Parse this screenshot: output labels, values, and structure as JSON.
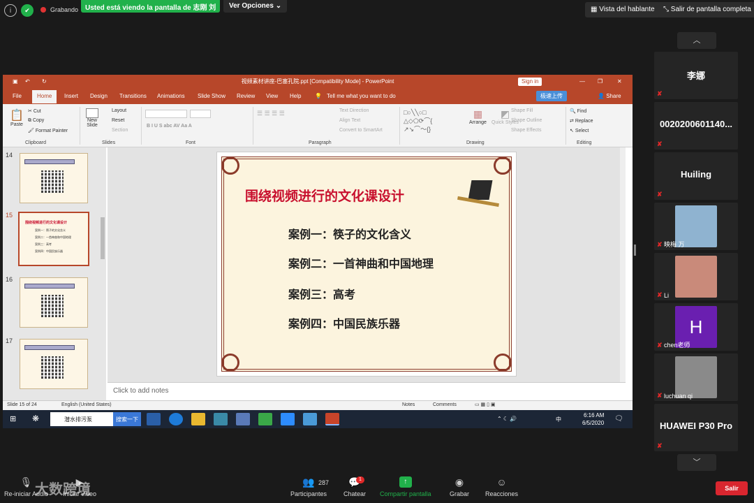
{
  "topbar": {
    "sharing_banner": "Usted está viendo la pantalla de 志刚 刘",
    "view_options": "Ver Opciones",
    "recording": "Grabando",
    "speaker_view": "Vista del hablante",
    "exit_fullscreen": "Salir de pantalla completa"
  },
  "ppt": {
    "title": "视频素材讲座-巴塞孔院.ppt [Compatibility Mode]  -  PowerPoint",
    "sign_in": "Sign in",
    "share_btn": "Share",
    "upload": "极速上传",
    "tabs": [
      "File",
      "Home",
      "Insert",
      "Design",
      "Transitions",
      "Animations",
      "Slide Show",
      "Review",
      "View",
      "Help",
      "Tell me what you want to do"
    ],
    "ribbon": {
      "paste": "Paste",
      "cut": "Cut",
      "copy": "Copy",
      "format_painter": "Format Painter",
      "new_slide": "New Slide",
      "layout": "Layout",
      "reset": "Reset",
      "section": "Section",
      "text_direction": "Text Direction",
      "align_text": "Align Text",
      "convert_smartart": "Convert to SmartArt",
      "arrange": "Arrange",
      "quick_styles": "Quick Styles",
      "shape_fill": "Shape Fill",
      "shape_outline": "Shape Outline",
      "shape_effects": "Shape Effects",
      "find": "Find",
      "replace": "Replace",
      "select": "Select",
      "groups": [
        "Clipboard",
        "Slides",
        "Font",
        "Paragraph",
        "Drawing",
        "Editing"
      ]
    },
    "slide_numbers": [
      "14",
      "15",
      "16",
      "17"
    ],
    "slide": {
      "title": "围绕视频进行的文化课设计",
      "cases": [
        "案例一：筷子的文化含义",
        "案例二：一首神曲和中国地理",
        "案例三：高考",
        "案例四：中国民族乐器"
      ]
    },
    "notes_placeholder": "Click to add notes",
    "status": {
      "slide_info": "Slide 15 of 24",
      "language": "English (United States)",
      "notes": "Notes",
      "comments": "Comments"
    }
  },
  "taskbar": {
    "search_text": "潜水排污泵",
    "search_button": "搜索一下",
    "time": "6:16 AM",
    "date": "6/5/2020",
    "ime": "中"
  },
  "participants": [
    {
      "name": "李娜",
      "type": "name"
    },
    {
      "name": "0020200601140...",
      "type": "name"
    },
    {
      "name": "Huiling",
      "type": "name"
    },
    {
      "name": "映梅 万",
      "type": "video",
      "color": "#8fb3d0"
    },
    {
      "name": "Li",
      "type": "video",
      "color": "#c98a7a"
    },
    {
      "name": "chen老师",
      "type": "avatar",
      "letter": "H",
      "color": "#6a1fb0"
    },
    {
      "name": "luchuan qi",
      "type": "video",
      "color": "#8a8a8a"
    },
    {
      "name": "HUAWEI P30 Pro",
      "type": "name"
    }
  ],
  "bottombar": {
    "mute": "Re-iniciar Audio",
    "video": "Iniciar video",
    "participants": "Participantes",
    "participants_count": "287",
    "chat": "Chatear",
    "chat_badge": "1",
    "share": "Compartir pantalla",
    "record": "Grabar",
    "reactions": "Reacciones",
    "leave": "Salir",
    "watermark": "大数跨境"
  },
  "colors": {
    "ppt_accent": "#b7472a",
    "zoom_green": "#21b14b",
    "leave_red": "#d9262f",
    "slide_title": "#c8102e"
  }
}
